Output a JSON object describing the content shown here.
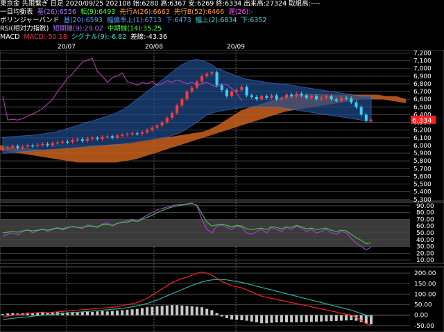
{
  "header": {
    "line1": [
      "東京金 先限繋ぎ 日足 2020/09/25 202108 始:6280 高:6367 安:6269 終:6334 出来高:27324 取組高:----"
    ],
    "line2": {
      "label": "一目均衡表",
      "base": "基(26):6556",
      "conv": "転(9):6493",
      "spanA": "先行A(26):6663",
      "spanB": "先行B(52):6466",
      "lag": "遅(26):-"
    },
    "line3": {
      "label": "ボリンジャーバンド",
      "mid": "基(20):6593",
      "hint1": "幅偏率上(1):6713",
      "lo1": "下:6473",
      "hint2": "幅上(2):6834",
      "lo2": "下:6352"
    },
    "line4": {
      "label": "RSI(相対力指数)",
      "short": "短期線(9):29.02",
      "mid": "中期線(14):35.25"
    },
    "line5": {
      "label": "MACD",
      "macd": "MACD:-50.18",
      "signal": "シグナル(9):-6.82",
      "diff": "差線:-43.36"
    }
  },
  "colors": {
    "price_up": "#ff3b3b",
    "price_down": "#3ad0ff",
    "cloud": "#c8601c",
    "bb_fill": "#1e4a8a",
    "rsi_short": "#a040d0",
    "rsi_mid": "#40c040",
    "macd": "#ff2020",
    "signal": "#30b0a0",
    "hist": "#c8c8c8",
    "price_tag": "#ff2020"
  },
  "chart_data": [
    {
      "type": "candlestick",
      "title": "東京金 先限繋ぎ 日足",
      "x_labels": [
        "20/07",
        "20/08",
        "20/09"
      ],
      "y_ticks": [
        7200,
        7100,
        7000,
        6900,
        6800,
        6700,
        6600,
        6500,
        6400,
        6300,
        6200,
        6100,
        6000,
        5900,
        5800,
        5700,
        5600,
        5500,
        5400,
        5300
      ],
      "ylim": [
        5280,
        7240
      ],
      "last_price": "6,334",
      "close": [
        5960,
        5975,
        5990,
        5970,
        5985,
        6000,
        5995,
        6010,
        6020,
        6005,
        6030,
        6040,
        6050,
        6045,
        6070,
        6080,
        6060,
        6090,
        6100,
        6085,
        6110,
        6120,
        6100,
        6130,
        6140,
        6150,
        6160,
        6150,
        6170,
        6200,
        6230,
        6260,
        6300,
        6360,
        6420,
        6520,
        6600,
        6700,
        6750,
        6830,
        6900,
        6930,
        6950,
        6780,
        6720,
        6640,
        6700,
        6720,
        6760,
        6650,
        6630,
        6600,
        6640,
        6620,
        6650,
        6600,
        6620,
        6660,
        6640,
        6670,
        6650,
        6620,
        6640,
        6600,
        6620,
        6640,
        6600,
        6580,
        6620,
        6610,
        6560,
        6500,
        6400,
        6320,
        6334
      ],
      "bb_upper": [
        6100,
        6110,
        6115,
        6120,
        6125,
        6130,
        6135,
        6140,
        6150,
        6160,
        6170,
        6180,
        6200,
        6220,
        6240,
        6260,
        6280,
        6300,
        6320,
        6340,
        6360,
        6380,
        6400,
        6430,
        6460,
        6500,
        6550,
        6600,
        6650,
        6700,
        6750,
        6800,
        6850,
        6900,
        6950,
        7000,
        7050,
        7080,
        7100,
        7120,
        7100,
        7080,
        7050,
        7000,
        6980,
        6950,
        6930,
        6900,
        6880,
        6860,
        6850,
        6840,
        6830,
        6820,
        6810,
        6800,
        6800,
        6790,
        6780,
        6770,
        6760,
        6750,
        6740,
        6730,
        6720,
        6710,
        6700,
        6690,
        6680,
        6670,
        6660,
        6650,
        6640,
        6640,
        6640
      ],
      "bb_lower": [
        5900,
        5905,
        5910,
        5915,
        5920,
        5925,
        5930,
        5935,
        5940,
        5945,
        5950,
        5955,
        5960,
        5965,
        5970,
        5975,
        5980,
        5985,
        5990,
        5995,
        6000,
        6005,
        6010,
        6015,
        6020,
        6030,
        6040,
        6050,
        6060,
        6070,
        6080,
        6090,
        6100,
        6110,
        6130,
        6150,
        6180,
        6220,
        6260,
        6300,
        6350,
        6400,
        6420,
        6440,
        6450,
        6460,
        6470,
        6480,
        6490,
        6500,
        6500,
        6500,
        6500,
        6500,
        6500,
        6500,
        6490,
        6480,
        6470,
        6460,
        6450,
        6440,
        6430,
        6420,
        6410,
        6400,
        6390,
        6380,
        6370,
        6360,
        6350,
        6340,
        6330,
        6320,
        6310
      ],
      "cloud_top": [
        6000,
        5990,
        5980,
        5975,
        5970,
        5965,
        5960,
        5955,
        5950,
        5950,
        5950,
        5950,
        5955,
        5960,
        5965,
        5970,
        5975,
        5980,
        5985,
        5990,
        5995,
        6000,
        6005,
        6010,
        6015,
        6020,
        6025,
        6030,
        6040,
        6050,
        6060,
        6070,
        6080,
        6090,
        6100,
        6110,
        6120,
        6130,
        6140,
        6150,
        6160,
        6170,
        6180,
        6200,
        6230,
        6260,
        6300,
        6340,
        6380,
        6420,
        6460,
        6480,
        6500,
        6520,
        6540,
        6560,
        6580,
        6600,
        6620,
        6640,
        6650,
        6660,
        6670,
        6670,
        6670,
        6670,
        6670,
        6670,
        6660,
        6660,
        6660,
        6660,
        6660,
        6660,
        6660,
        6660,
        6660,
        6660,
        6660,
        6650,
        6640,
        6640,
        6640,
        6620,
        6600
      ],
      "cloud_bot": [
        5940,
        5930,
        5920,
        5910,
        5900,
        5890,
        5880,
        5870,
        5860,
        5850,
        5840,
        5830,
        5820,
        5810,
        5800,
        5790,
        5780,
        5780,
        5780,
        5780,
        5780,
        5780,
        5780,
        5780,
        5780,
        5790,
        5800,
        5810,
        5820,
        5840,
        5860,
        5880,
        5900,
        5920,
        5940,
        5960,
        5980,
        6000,
        6020,
        6040,
        6060,
        6080,
        6100,
        6120,
        6140,
        6160,
        6180,
        6200,
        6220,
        6240,
        6260,
        6280,
        6300,
        6320,
        6340,
        6360,
        6380,
        6400,
        6420,
        6440,
        6450,
        6460,
        6470,
        6480,
        6490,
        6500,
        6510,
        6520,
        6530,
        6540,
        6550,
        6560,
        6570,
        6580,
        6590,
        6600,
        6600,
        6600,
        6600,
        6600,
        6590,
        6580,
        6570,
        6560,
        6550
      ]
    },
    {
      "type": "line",
      "title": "RSI(相対力指数)",
      "y_ticks": [
        90,
        80,
        70,
        60,
        50,
        40,
        30,
        20,
        10
      ],
      "ylim": [
        5,
        95
      ],
      "series": [
        {
          "name": "短期線(9)",
          "values": [
            45,
            48,
            50,
            47,
            52,
            55,
            50,
            53,
            56,
            52,
            55,
            58,
            54,
            57,
            60,
            58,
            56,
            62,
            60,
            58,
            63,
            65,
            60,
            64,
            66,
            68,
            70,
            67,
            72,
            76,
            80,
            84,
            86,
            88,
            90,
            92,
            92,
            93,
            94,
            90,
            70,
            55,
            50,
            60,
            62,
            58,
            55,
            60,
            58,
            50,
            48,
            52,
            55,
            50,
            58,
            55,
            52,
            58,
            55,
            60,
            57,
            52,
            55,
            50,
            52,
            55,
            50,
            48,
            52,
            50,
            42,
            35,
            30,
            25,
            29.02
          ]
        },
        {
          "name": "中期線(14)",
          "values": [
            50,
            51,
            52,
            51,
            53,
            54,
            53,
            54,
            55,
            54,
            56,
            57,
            56,
            58,
            59,
            58,
            58,
            60,
            60,
            59,
            62,
            63,
            61,
            64,
            65,
            66,
            68,
            67,
            70,
            73,
            76,
            80,
            83,
            86,
            88,
            90,
            91,
            92,
            93,
            91,
            78,
            66,
            60,
            62,
            63,
            61,
            59,
            61,
            60,
            56,
            55,
            56,
            57,
            55,
            59,
            58,
            56,
            59,
            58,
            61,
            59,
            56,
            57,
            55,
            56,
            57,
            54,
            52,
            54,
            53,
            48,
            43,
            39,
            34,
            35.25
          ]
        }
      ]
    },
    {
      "type": "line",
      "title": "MACD",
      "y_ticks": [
        200,
        150,
        100,
        50,
        0,
        -50
      ],
      "ylim": [
        -80,
        230
      ],
      "series": [
        {
          "name": "MACD",
          "values": [
            -10,
            -5,
            0,
            2,
            5,
            8,
            10,
            12,
            15,
            12,
            14,
            16,
            18,
            20,
            22,
            24,
            26,
            28,
            30,
            32,
            34,
            36,
            38,
            40,
            45,
            50,
            55,
            60,
            70,
            80,
            95,
            110,
            125,
            140,
            155,
            165,
            175,
            180,
            190,
            200,
            205,
            200,
            190,
            175,
            160,
            150,
            140,
            135,
            130,
            120,
            110,
            100,
            90,
            85,
            80,
            75,
            70,
            65,
            60,
            55,
            50,
            45,
            40,
            35,
            30,
            25,
            20,
            15,
            10,
            5,
            0,
            -10,
            -25,
            -40,
            -50.18
          ]
        },
        {
          "name": "シグナル(9)",
          "values": [
            -20,
            -18,
            -15,
            -12,
            -10,
            -8,
            -5,
            -2,
            0,
            2,
            4,
            6,
            8,
            10,
            12,
            14,
            16,
            18,
            20,
            22,
            24,
            26,
            28,
            30,
            33,
            36,
            40,
            44,
            50,
            56,
            64,
            72,
            82,
            92,
            102,
            112,
            122,
            132,
            142,
            150,
            158,
            164,
            168,
            170,
            170,
            168,
            164,
            160,
            156,
            150,
            144,
            138,
            132,
            126,
            120,
            114,
            108,
            102,
            96,
            90,
            84,
            78,
            72,
            66,
            60,
            54,
            48,
            42,
            36,
            30,
            24,
            16,
            8,
            0,
            -6.82
          ]
        }
      ],
      "histogram": [
        5,
        8,
        10,
        8,
        10,
        12,
        10,
        12,
        14,
        10,
        12,
        14,
        12,
        14,
        16,
        14,
        16,
        18,
        16,
        18,
        20,
        18,
        20,
        22,
        24,
        26,
        28,
        30,
        34,
        38,
        40,
        42,
        44,
        46,
        48,
        48,
        46,
        44,
        42,
        40,
        38,
        30,
        24,
        10,
        -6,
        -14,
        -20,
        -22,
        -24,
        -26,
        -30,
        -34,
        -38,
        -38,
        -36,
        -34,
        -34,
        -34,
        -34,
        -34,
        -34,
        -33,
        -32,
        -31,
        -30,
        -29,
        -28,
        -27,
        -26,
        -25,
        -24,
        -26,
        -33,
        -40,
        -43.36
      ]
    }
  ]
}
